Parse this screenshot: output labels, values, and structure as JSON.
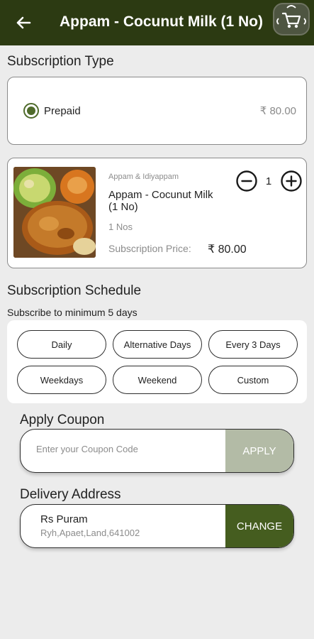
{
  "header": {
    "title": "Appam - Cocunut Milk (1 No)",
    "back_icon": "arrow-left-icon",
    "cart_icon": "cart-icon"
  },
  "subscription_type": {
    "title": "Subscription Type",
    "option_label": "Prepaid",
    "option_selected": true,
    "price": "₹ 80.00"
  },
  "product": {
    "category": "Appam & Idiyappam",
    "name": "Appam - Cocunut Milk (1 No)",
    "quantity_text": "1 Nos",
    "subscription_price_label": "Subscription Price:",
    "subscription_price": "₹ 80.00",
    "quantity": "1"
  },
  "schedule": {
    "title": "Subscription Schedule",
    "note": "Subscribe to minimum 5 days",
    "options": [
      "Daily",
      "Alternative Days",
      "Every 3 Days",
      "Weekdays",
      "Weekend",
      "Custom"
    ]
  },
  "coupon": {
    "title": "Apply Coupon",
    "placeholder": "Enter your Coupon Code",
    "button_label": "APPLY"
  },
  "address": {
    "title": "Delivery Address",
    "name": "Rs Puram",
    "line": "Ryh,Apaet,Land,641002",
    "button_label": "CHANGE"
  },
  "colors": {
    "appbar": "#2c3a12",
    "accent": "#4f6b2b",
    "apply_button": "#b3bba6",
    "change_button": "#455d1f"
  }
}
